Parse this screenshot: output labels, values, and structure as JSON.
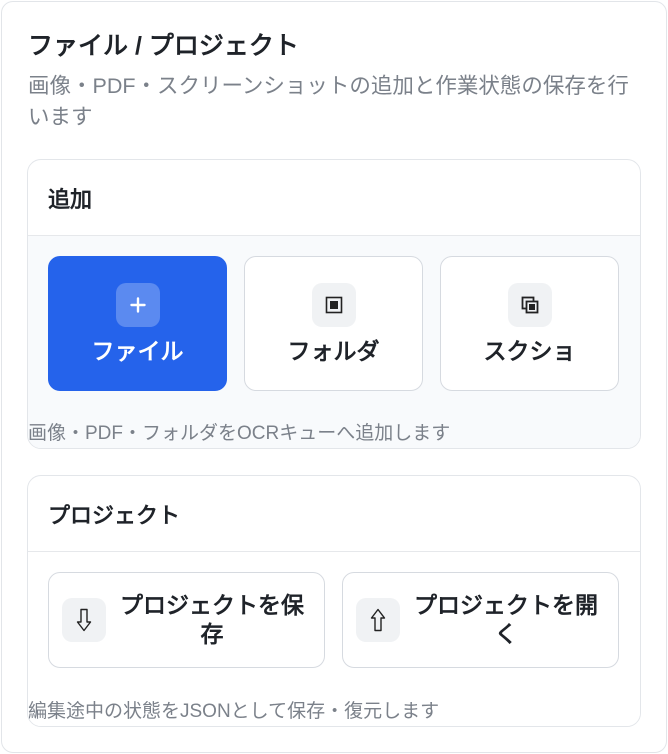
{
  "panel": {
    "title": "ファイル / プロジェクト",
    "subtitle": "画像・PDF・スクリーンショットの追加と作業状態の保存を行います"
  },
  "add_section": {
    "title": "追加",
    "buttons": [
      {
        "label": "ファイル",
        "icon": "plus-icon",
        "primary": true
      },
      {
        "label": "フォルダ",
        "icon": "folder-icon",
        "primary": false
      },
      {
        "label": "スクショ",
        "icon": "screenshot-icon",
        "primary": false
      }
    ],
    "hint": "画像・PDF・フォルダをOCRキューへ追加します"
  },
  "project_section": {
    "title": "プロジェクト",
    "buttons": [
      {
        "label": "プロジェクトを保存",
        "icon": "download-icon"
      },
      {
        "label": "プロジェクトを開く",
        "icon": "upload-icon"
      }
    ],
    "hint": "編集途中の状態をJSONとして保存・復元します"
  },
  "colors": {
    "accent": "#2563eb",
    "muted_text": "#7b818a",
    "text": "#1f2329"
  }
}
